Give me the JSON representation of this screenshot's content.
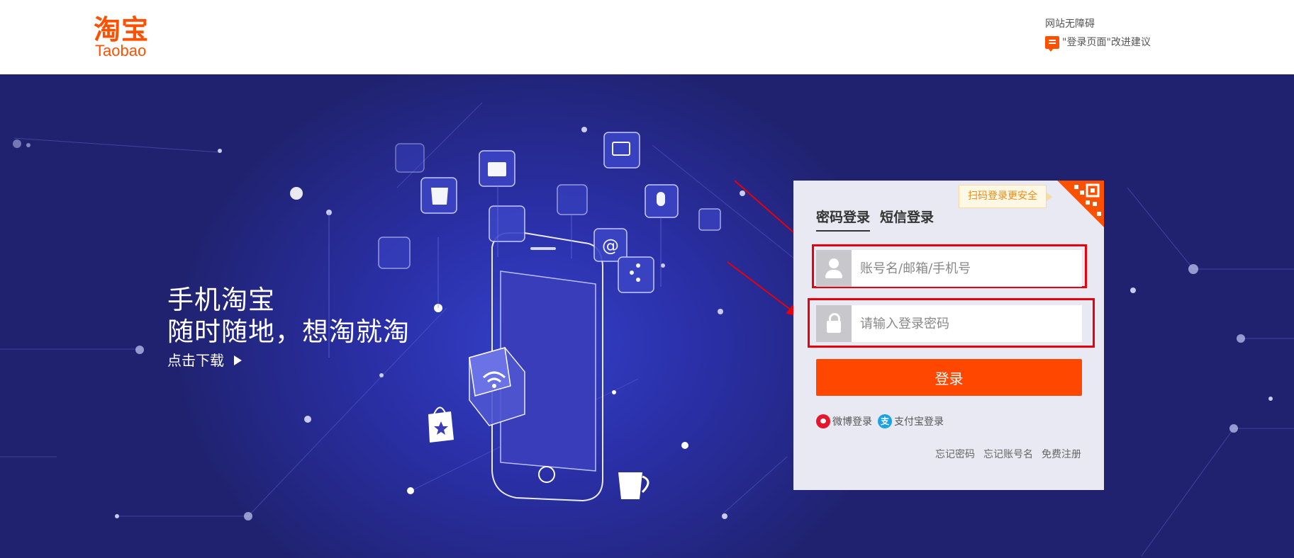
{
  "header": {
    "logo_cn": "淘宝",
    "logo_en": "Taobao",
    "accessibility_link": "网站无障碍",
    "feedback_link": "\"登录页面\"改进建议"
  },
  "banner": {
    "title": "手机淘宝",
    "subtitle": "随时随地，想淘就淘",
    "download_link": "点击下载"
  },
  "login": {
    "qr_tip": "扫码登录更安全",
    "tabs": [
      "密码登录",
      "短信登录"
    ],
    "active_tab": 0,
    "username_placeholder": "账号名/邮箱/手机号",
    "password_placeholder": "请输入登录密码",
    "submit_label": "登录",
    "social": {
      "weibo": "微博登录",
      "alipay": "支付宝登录"
    },
    "links": {
      "forgot_password": "忘记密码",
      "forgot_account": "忘记账号名",
      "register": "免费注册"
    }
  },
  "colors": {
    "brand": "#ff5000",
    "login_button": "#ff4700",
    "annotation_red": "#e8000b",
    "banner_bg": "#2a2fa6"
  }
}
